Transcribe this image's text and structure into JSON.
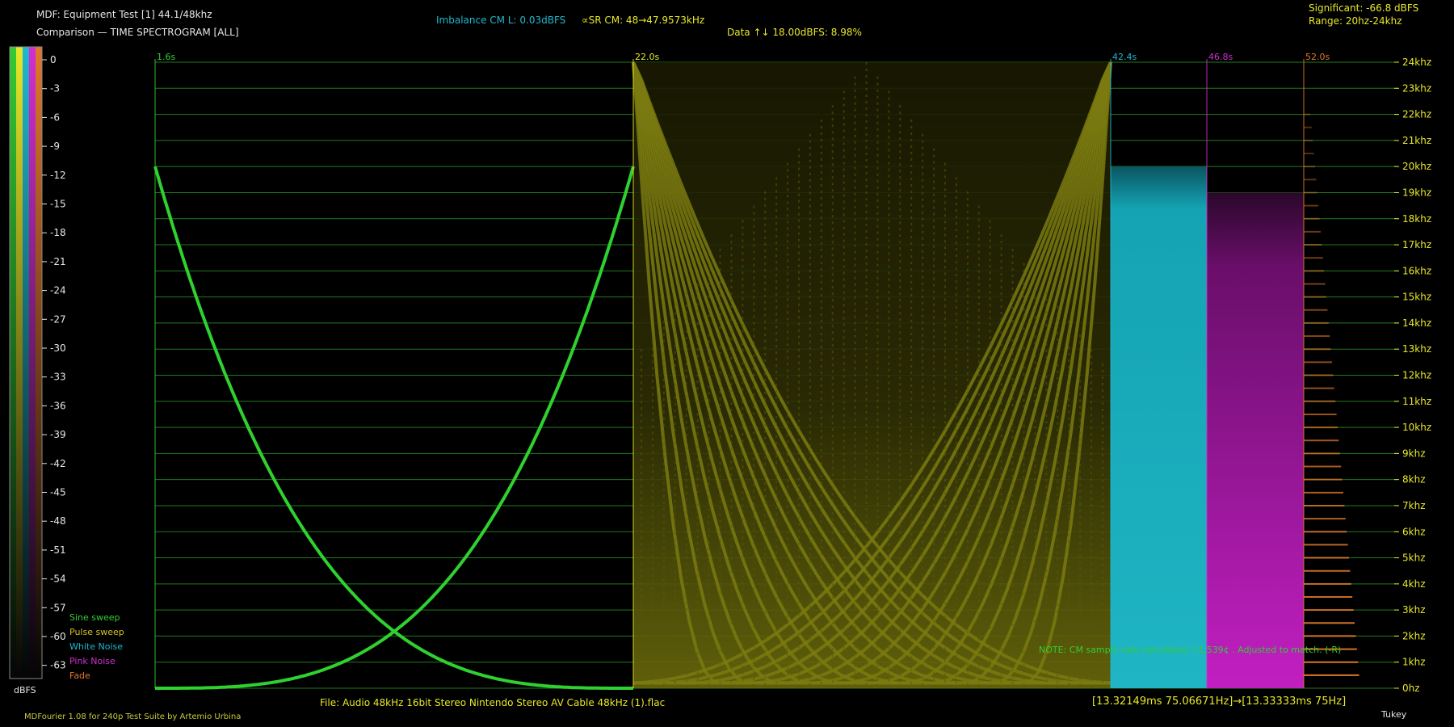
{
  "header": {
    "title_line": "MDF: Equipment Test [1] 44.1/48khz",
    "subtitle_line": "Comparison — TIME SPECTROGRAM [ALL]",
    "imbalance": "Imbalance CM L: 0.03dBFS",
    "sample_rate": "∝SR CM: 48→47.9573kHz",
    "data_diff": "Data ↑↓ 18.00dBFS: 8.98%",
    "significant": "Significant: -66.8 dBFS",
    "range": "Range: 20hz-24khz"
  },
  "colors": {
    "background": "#000000",
    "grid": "#1f7a1f",
    "sine": "#2fd12f",
    "pulse": "#8a8a12",
    "white_noise": "#1fb5c4",
    "pink_noise": "#c21fc2",
    "fade": "#e0782a",
    "axis_text": "#e8e82a",
    "note_text": "#33cc33"
  },
  "legend": {
    "items": [
      {
        "label": "Sine sweep",
        "color": "#33cc33"
      },
      {
        "label": "Pulse sweep",
        "color": "#d4c02a"
      },
      {
        "label": "White Noise",
        "color": "#1fb8cf"
      },
      {
        "label": "Pink Noise",
        "color": "#d22fd2"
      },
      {
        "label": "Fade",
        "color": "#e0782a"
      }
    ]
  },
  "colorbar": {
    "unit": "dBFS",
    "ticks": [
      "0",
      "-3",
      "-6",
      "-9",
      "-12",
      "-15",
      "-18",
      "-21",
      "-24",
      "-27",
      "-30",
      "-33",
      "-36",
      "-39",
      "-42",
      "-45",
      "-48",
      "-51",
      "-54",
      "-57",
      "-60",
      "-63"
    ],
    "stripe_colors": [
      "#33cc33",
      "#e8e82a",
      "#1fb8cf",
      "#d22fd2",
      "#e0782a"
    ]
  },
  "chart_data": {
    "type": "heatmap",
    "title": "TIME SPECTROGRAM [ALL]",
    "xlabel": "",
    "ylabel": "",
    "ylim_khz": [
      0,
      24
    ],
    "y_ticks": [
      "0hz",
      "1khz",
      "2khz",
      "3khz",
      "4khz",
      "5khz",
      "6khz",
      "7khz",
      "8khz",
      "9khz",
      "10khz",
      "11khz",
      "12khz",
      "13khz",
      "14khz",
      "15khz",
      "16khz",
      "17khz",
      "18khz",
      "19khz",
      "20khz",
      "21khz",
      "22khz",
      "23khz",
      "24khz"
    ],
    "time_markers": [
      {
        "label": "1.6s",
        "color": "#33cc33"
      },
      {
        "label": "22.0s",
        "color": "#e8e82a"
      },
      {
        "label": "42.4s",
        "color": "#1fb8cf"
      },
      {
        "label": "46.8s",
        "color": "#d22fd2"
      },
      {
        "label": "52.0s",
        "color": "#e0782a"
      }
    ],
    "series": [
      {
        "name": "Sine sweep",
        "start_s": 1.6,
        "end_s": 22.0,
        "max_khz": 20
      },
      {
        "name": "Pulse sweep",
        "start_s": 22.0,
        "end_s": 42.4,
        "max_khz": 24
      },
      {
        "name": "White Noise",
        "start_s": 42.4,
        "end_s": 46.8,
        "max_khz": 20
      },
      {
        "name": "Pink Noise",
        "start_s": 46.8,
        "end_s": 52.0,
        "max_khz": 19
      },
      {
        "name": "Fade",
        "start_s": 52.0,
        "end_s": 52.0,
        "max_khz": 22
      }
    ],
    "grid": true
  },
  "footer": {
    "file": "File: Audio   48kHz 16bit Stereo Nintendo Stereo AV Cable 48kHz (1).flac",
    "timing": "[13.32149ms 75.06671Hz]→[13.33333ms 75Hz]",
    "credits": "MDFourier 1.08 for 240p Test Suite by Artemio Urbina",
    "window": "Tukey"
  },
  "note": "NOTE: CM sample rate calculated +1.539¢ . Adjusted to match. (-R)"
}
